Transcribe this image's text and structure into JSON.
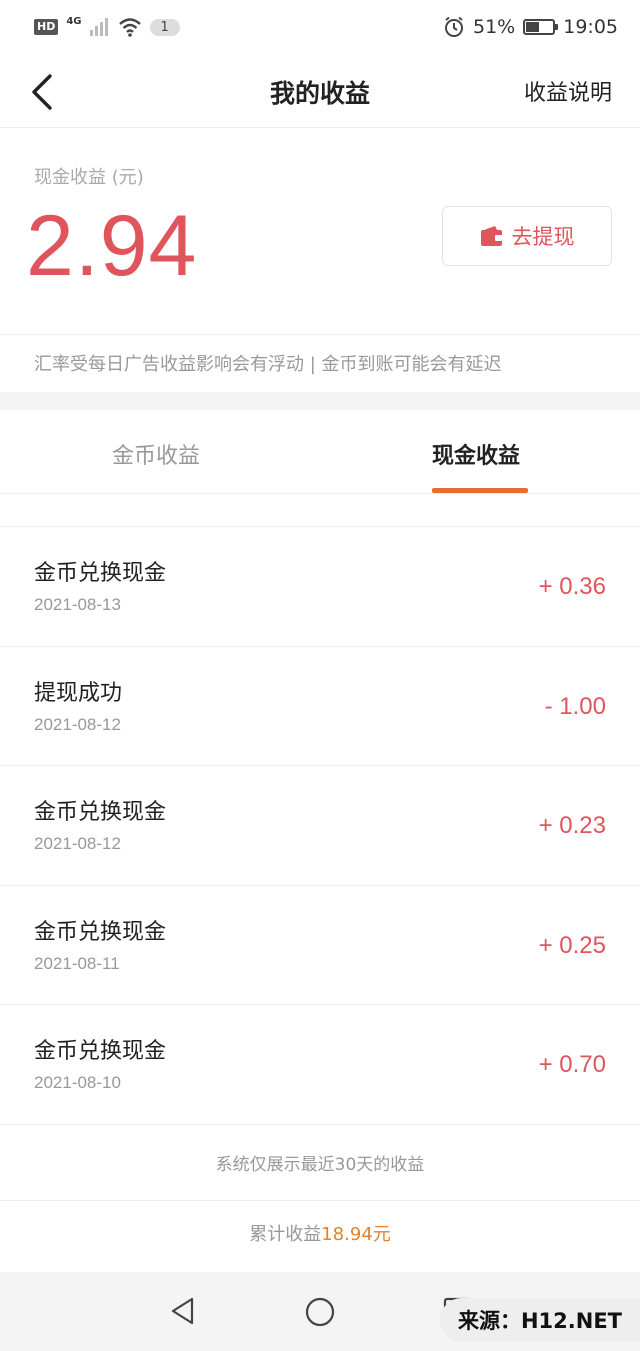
{
  "status_bar": {
    "hd": "HD",
    "network": "4G",
    "notification_count": "1",
    "battery_percent": "51%",
    "battery_level": 0.51,
    "time": "19:05"
  },
  "header": {
    "title": "我的收益",
    "help_label": "收益说明"
  },
  "earnings": {
    "label": "现金收益 (元)",
    "amount": "2.94",
    "withdraw_label": "去提现",
    "note": "汇率受每日广告收益影响会有浮动 | 金币到账可能会有延迟"
  },
  "tabs": [
    {
      "label": "金币收益",
      "active": false
    },
    {
      "label": "现金收益",
      "active": true
    }
  ],
  "records": [
    {
      "title": "金币兑换现金",
      "date": "2021-08-13",
      "amount": "+ 0.36"
    },
    {
      "title": "提现成功",
      "date": "2021-08-12",
      "amount": "- 1.00"
    },
    {
      "title": "金币兑换现金",
      "date": "2021-08-12",
      "amount": "+ 0.23"
    },
    {
      "title": "金币兑换现金",
      "date": "2021-08-11",
      "amount": "+ 0.25"
    },
    {
      "title": "金币兑换现金",
      "date": "2021-08-10",
      "amount": "+ 0.70"
    }
  ],
  "footer": {
    "note": "系统仅展示最近30天的收益",
    "total_prefix": "累计收益",
    "total_value": "18.94元"
  },
  "watermark": "来源：H12.NET",
  "colors": {
    "accent_red": "#e0555b",
    "tab_indicator": "#e96b2f",
    "total_orange": "#e0832a"
  }
}
